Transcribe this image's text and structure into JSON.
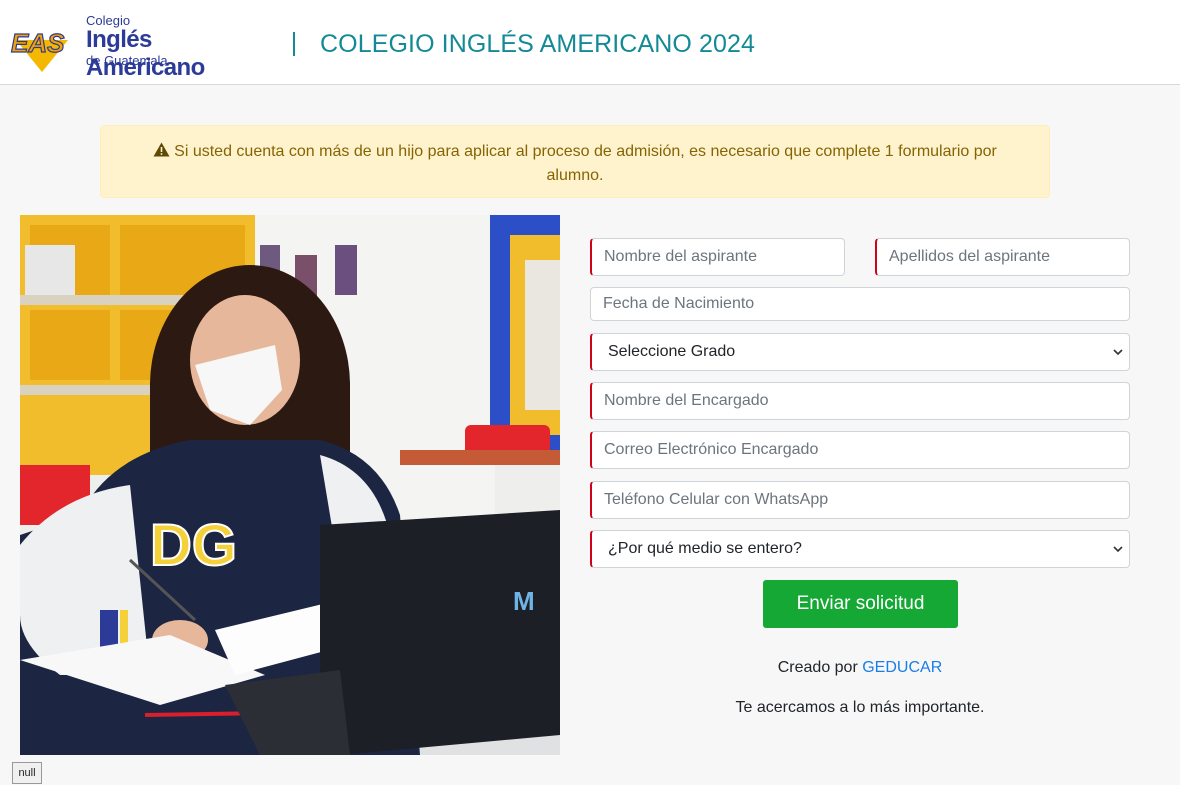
{
  "header": {
    "logo": {
      "mark": "EAS",
      "line1": "Colegio",
      "line2": "Inglés Americano",
      "line3": "de Guatemala"
    },
    "title": "COLEGIO INGLÉS AMERICANO 2024"
  },
  "alert": {
    "icon": "warning-icon",
    "text": "Si usted cuenta con más de un hijo para aplicar al proceso de admisión, es necesario que complete 1 formulario por alumno."
  },
  "form": {
    "first_name_placeholder": "Nombre del aspirante",
    "last_name_placeholder": "Apellidos del aspirante",
    "birthdate_placeholder": "Fecha de Nacimiento",
    "grade_select": "Seleccione Grado",
    "guardian_placeholder": "Nombre del Encargado",
    "email_placeholder": "Correo Electrónico Encargado",
    "phone_placeholder": "Teléfono Celular con WhatsApp",
    "source_select": "¿Por qué medio se entero?",
    "submit_label": "Enviar solicitud"
  },
  "footer": {
    "credit_prefix": "Creado por",
    "credit_link": "GEDUCAR",
    "tagline": "Te acercamos a lo más importante."
  },
  "debug_badge": "null",
  "colors": {
    "accent": "#138a96",
    "brand": "#2c3b97",
    "required": "#d0021b",
    "submit": "#16a834",
    "link": "#1a7ee8"
  }
}
